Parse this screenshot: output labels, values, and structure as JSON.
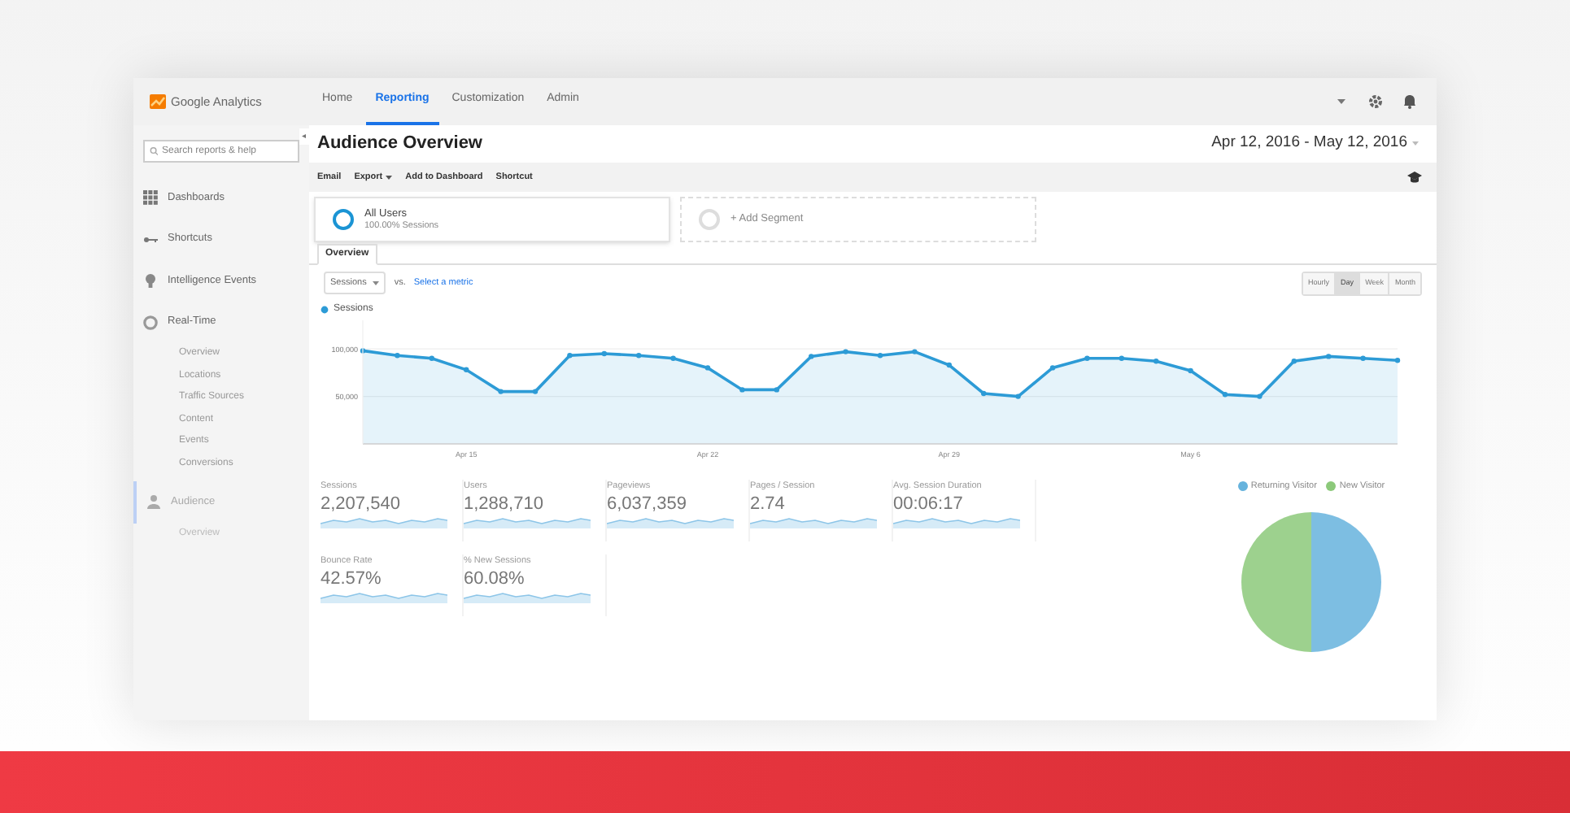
{
  "app": {
    "product": "Google Analytics"
  },
  "nav": [
    {
      "label": "Home",
      "selected": false
    },
    {
      "label": "Reporting",
      "selected": true
    },
    {
      "label": "Customization",
      "selected": false
    },
    {
      "label": "Admin",
      "selected": false
    }
  ],
  "sidebar": {
    "search": {
      "placeholder": "Search reports & help"
    },
    "collapse_glyph": "◂",
    "items": [
      {
        "label": "Dashboards",
        "selected": false
      },
      {
        "label": "Shortcuts",
        "selected": false
      },
      {
        "label": "Intelligence Events",
        "selected": false
      },
      {
        "label": "Real-Time",
        "selected": false,
        "children": [
          {
            "label": "Overview"
          },
          {
            "label": "Locations"
          },
          {
            "label": "Traffic Sources"
          },
          {
            "label": "Content"
          },
          {
            "label": "Events"
          },
          {
            "label": "Conversions"
          }
        ]
      },
      {
        "label": "Audience",
        "selected": true,
        "children": [
          {
            "label": "Overview"
          }
        ]
      }
    ]
  },
  "report": {
    "title": "Audience Overview",
    "date_range": "Apr 12, 2016 - May 12, 2016",
    "actions": [
      {
        "label": "Email",
        "caret": false
      },
      {
        "label": "Export",
        "caret": true
      },
      {
        "label": "Add to Dashboard",
        "caret": false
      },
      {
        "label": "Shortcut",
        "caret": false
      }
    ],
    "segments": [
      {
        "kind": "segment",
        "label": "All Users",
        "sub": "100.00% Sessions"
      },
      {
        "kind": "add",
        "label": "+ Add Segment"
      }
    ],
    "tabs": [
      {
        "label": "Overview",
        "selected": true
      }
    ],
    "metric_select": {
      "value": "Sessions",
      "vs": "vs.",
      "link": "Select a metric"
    },
    "intervals": [
      {
        "label": "Hourly",
        "selected": false
      },
      {
        "label": "Day",
        "selected": true
      },
      {
        "label": "Week",
        "selected": false
      },
      {
        "label": "Month",
        "selected": false
      }
    ],
    "chart_data": {
      "type": "area",
      "ylim": [
        0,
        130000
      ],
      "categories": [
        null,
        null,
        null,
        "Apr 15",
        null,
        null,
        null,
        null,
        null,
        null,
        "Apr 22",
        null,
        null,
        null,
        null,
        null,
        null,
        "Apr 29",
        null,
        null,
        null,
        null,
        null,
        null,
        "May 6",
        null,
        null,
        null,
        null,
        null,
        null
      ],
      "yticks": [
        {
          "value": 50000,
          "label": "50,000"
        },
        {
          "value": 100000,
          "label": "100,000"
        }
      ],
      "series": [
        {
          "name": "Sessions",
          "color": "#2d9bd6",
          "values": [
            98000,
            93000,
            90000,
            78000,
            55000,
            55000,
            93000,
            95000,
            93000,
            90000,
            80000,
            57000,
            57000,
            92000,
            97000,
            93000,
            97000,
            83000,
            53000,
            50000,
            80000,
            90000,
            90000,
            87000,
            77000,
            52000,
            50000,
            87000,
            92000,
            90000,
            88000
          ]
        }
      ]
    },
    "metrics": [
      {
        "label": "Sessions",
        "value": "2,207,540"
      },
      {
        "label": "Users",
        "value": "1,288,710"
      },
      {
        "label": "Pageviews",
        "value": "6,037,359"
      },
      {
        "label": "Pages / Session",
        "value": "2.74"
      },
      {
        "label": "Avg. Session Duration",
        "value": "00:06:17"
      },
      {
        "label": "Bounce Rate",
        "value": "42.57%"
      },
      {
        "label": "% New Sessions",
        "value": "60.08%"
      }
    ],
    "pie": {
      "legend": [
        {
          "label": "Returning Visitor",
          "color": "#66b3dd"
        },
        {
          "label": "New Visitor",
          "color": "#8cc97a"
        }
      ]
    }
  }
}
